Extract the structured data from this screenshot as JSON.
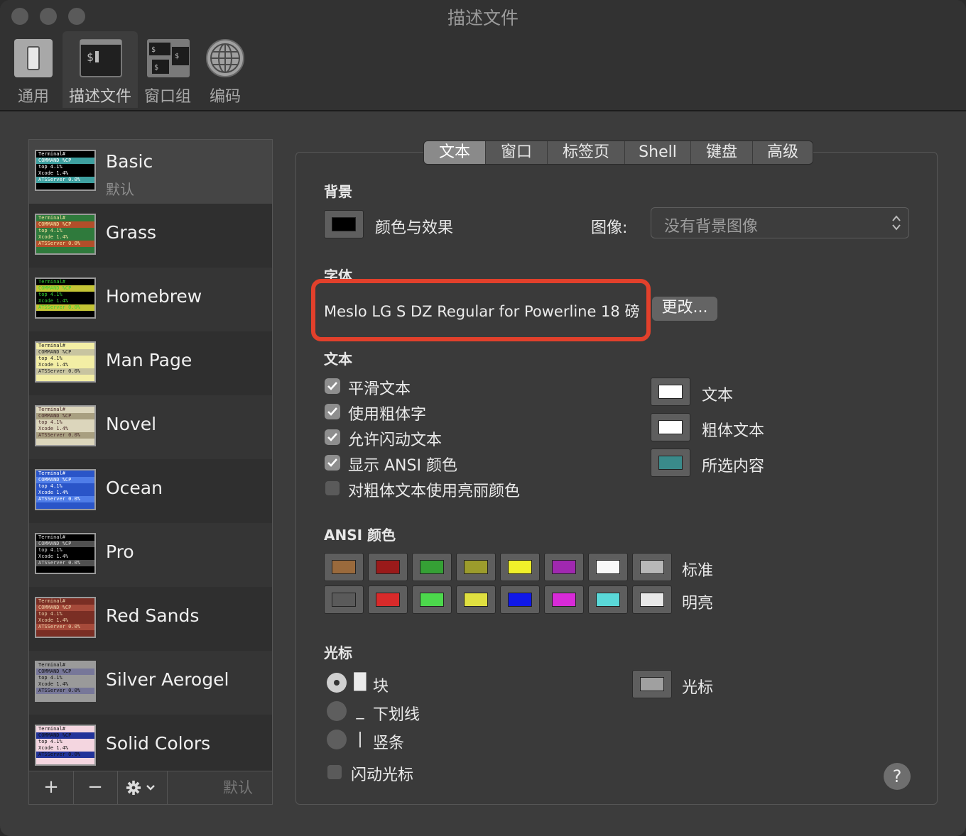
{
  "window": {
    "title": "描述文件"
  },
  "toolbar": [
    {
      "label": "通用",
      "icon": "switch-icon"
    },
    {
      "label": "描述文件",
      "icon": "terminal-icon"
    },
    {
      "label": "窗口组",
      "icon": "window-group-icon"
    },
    {
      "label": "编码",
      "icon": "globe-icon"
    }
  ],
  "profiles": [
    {
      "name": "Basic",
      "subtitle": "默认",
      "bg": "#000000",
      "fg": "#ffffff",
      "hl": "#3ea0a0"
    },
    {
      "name": "Grass",
      "bg": "#2f7a3c",
      "fg": "#f5e6a0",
      "hl": "#b24e2a"
    },
    {
      "name": "Homebrew",
      "bg": "#000000",
      "fg": "#36d336",
      "hl": "#c4c435"
    },
    {
      "name": "Man Page",
      "bg": "#f3eea5",
      "fg": "#222222",
      "hl": "#c8c4a0"
    },
    {
      "name": "Novel",
      "bg": "#dcd6bc",
      "fg": "#4a2a2a",
      "hl": "#a89f80"
    },
    {
      "name": "Ocean",
      "bg": "#2a55c8",
      "fg": "#ffffff",
      "hl": "#4f7de8"
    },
    {
      "name": "Pro",
      "bg": "#000000",
      "fg": "#d8d8d8",
      "hl": "#505050"
    },
    {
      "name": "Red Sands",
      "bg": "#7a2e24",
      "fg": "#e8cfa8",
      "hl": "#a64a3a"
    },
    {
      "name": "Silver Aerogel",
      "bg": "#9a9a9a",
      "fg": "#111111",
      "hl": "#777799"
    },
    {
      "name": "Solid Colors",
      "bg": "#f4d6e0",
      "fg": "#111111",
      "hl": "#223399"
    }
  ],
  "profile_thumb_lines": [
    "Terminal#",
    "COMMAND   %CP",
    "top       4.1%",
    "Xcode     1.4%",
    "ATSServer 0.0%"
  ],
  "sidebar_bar": {
    "add": "+",
    "remove": "−",
    "default": "默认"
  },
  "tabs": [
    "文本",
    "窗口",
    "标签页",
    "Shell",
    "键盘",
    "高级"
  ],
  "background": {
    "section": "背景",
    "color_effects": "颜色与效果",
    "image_label": "图像:",
    "image_value": "没有背景图像",
    "color": "#000000"
  },
  "font": {
    "section": "字体",
    "value": "Meslo LG S DZ Regular for Powerline 18 磅",
    "change": "更改..."
  },
  "text": {
    "section": "文本",
    "options": [
      {
        "label": "平滑文本",
        "checked": true
      },
      {
        "label": "使用粗体字",
        "checked": true
      },
      {
        "label": "允许闪动文本",
        "checked": true
      },
      {
        "label": "显示 ANSI 颜色",
        "checked": true
      },
      {
        "label": "对粗体文本使用亮丽颜色",
        "checked": false
      }
    ],
    "colors": [
      {
        "label": "文本",
        "color": "#ffffff"
      },
      {
        "label": "粗体文本",
        "color": "#ffffff"
      },
      {
        "label": "所选内容",
        "color": "#3a8a8a"
      }
    ]
  },
  "ansi": {
    "section": "ANSI 颜色",
    "standard_label": "标准",
    "bright_label": "明亮",
    "standard": [
      "#9a6a3c",
      "#9a1a1a",
      "#35a035",
      "#9c9c2c",
      "#f0f02a",
      "#a028b0",
      "#f8f8f8",
      "#b8b8b8"
    ],
    "bright": [
      "#5a5a5a",
      "#d82a2a",
      "#4cd84c",
      "#e0e040",
      "#1018e8",
      "#d82ad8",
      "#5ad8d8",
      "#e8e8e8"
    ]
  },
  "cursor": {
    "section": "光标",
    "options": [
      {
        "label": "块",
        "glyph": "█",
        "selected": true
      },
      {
        "label": "下划线",
        "glyph": "_",
        "selected": false
      },
      {
        "label": "竖条",
        "glyph": "|",
        "selected": false
      }
    ],
    "blink_label": "闪动光标",
    "blink": false,
    "color_label": "光标",
    "color": "#a0a0a0"
  },
  "help": "?"
}
